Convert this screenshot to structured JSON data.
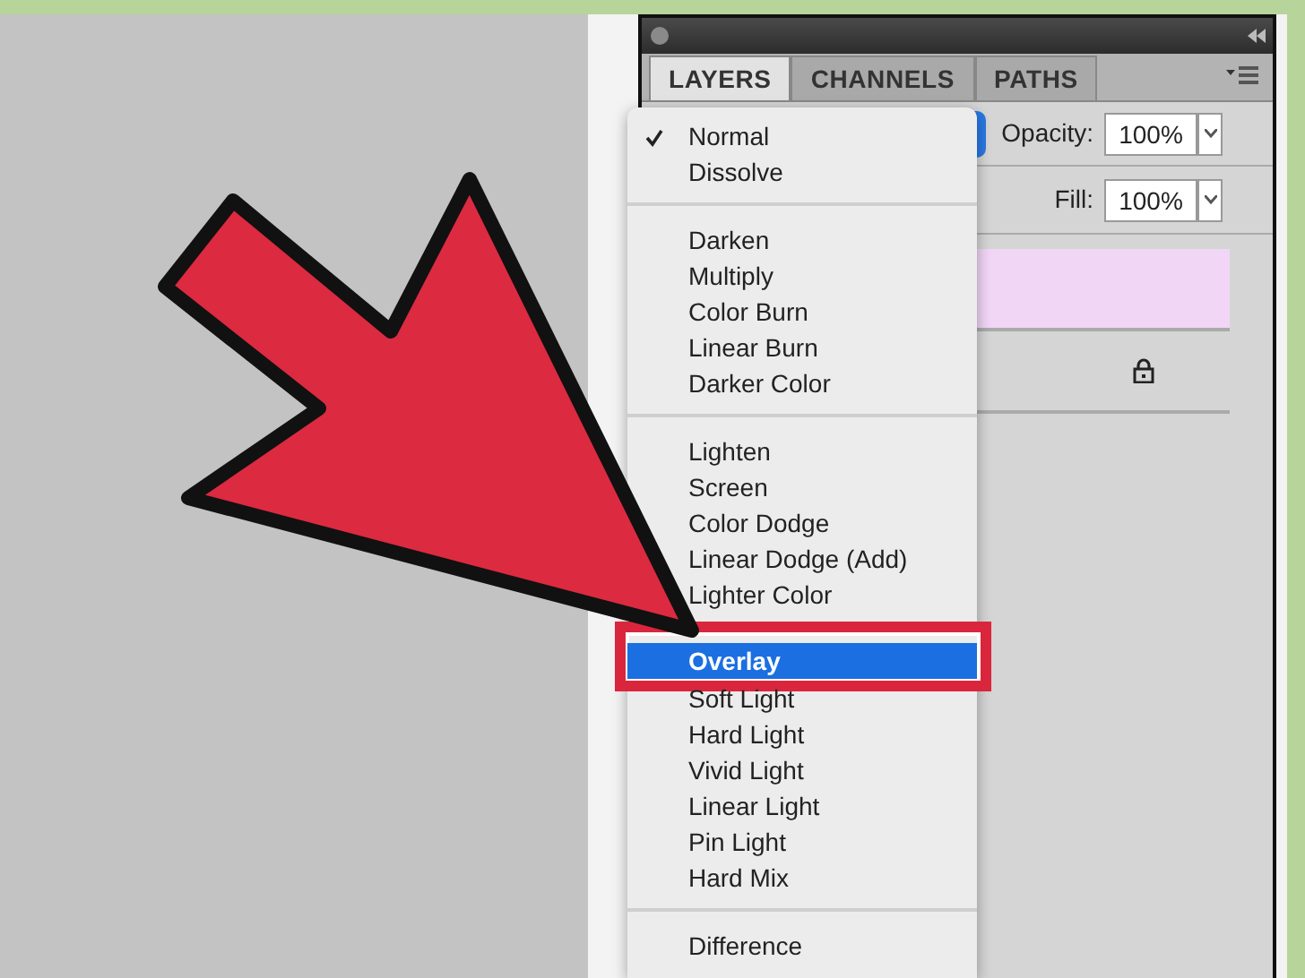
{
  "panel": {
    "tabs": [
      {
        "label": "LAYERS",
        "selected": true
      },
      {
        "label": "CHANNELS",
        "selected": false
      },
      {
        "label": "PATHS",
        "selected": false
      }
    ],
    "opacity": {
      "label": "Opacity:",
      "value": "100%"
    },
    "fill": {
      "label": "Fill:",
      "value": "100%"
    },
    "layers": [
      {
        "selected": true,
        "locked": false
      },
      {
        "selected": false,
        "locked": true
      }
    ]
  },
  "blend_menu": {
    "groups": [
      {
        "items": [
          {
            "label": "Normal",
            "checked": true,
            "selected": false
          },
          {
            "label": "Dissolve",
            "checked": false,
            "selected": false
          }
        ]
      },
      {
        "items": [
          {
            "label": "Darken",
            "checked": false,
            "selected": false
          },
          {
            "label": "Multiply",
            "checked": false,
            "selected": false
          },
          {
            "label": "Color Burn",
            "checked": false,
            "selected": false
          },
          {
            "label": "Linear Burn",
            "checked": false,
            "selected": false
          },
          {
            "label": "Darker Color",
            "checked": false,
            "selected": false
          }
        ]
      },
      {
        "items": [
          {
            "label": "Lighten",
            "checked": false,
            "selected": false
          },
          {
            "label": "Screen",
            "checked": false,
            "selected": false
          },
          {
            "label": "Color Dodge",
            "checked": false,
            "selected": false
          },
          {
            "label": "Linear Dodge (Add)",
            "checked": false,
            "selected": false
          },
          {
            "label": "Lighter Color",
            "checked": false,
            "selected": false
          }
        ]
      },
      {
        "items": [
          {
            "label": "Overlay",
            "checked": false,
            "selected": true
          },
          {
            "label": "Soft Light",
            "checked": false,
            "selected": false
          },
          {
            "label": "Hard Light",
            "checked": false,
            "selected": false
          },
          {
            "label": "Vivid Light",
            "checked": false,
            "selected": false
          },
          {
            "label": "Linear Light",
            "checked": false,
            "selected": false
          },
          {
            "label": "Pin Light",
            "checked": false,
            "selected": false
          },
          {
            "label": "Hard Mix",
            "checked": false,
            "selected": false
          }
        ]
      },
      {
        "items": [
          {
            "label": "Difference",
            "checked": false,
            "selected": false
          }
        ]
      }
    ]
  }
}
